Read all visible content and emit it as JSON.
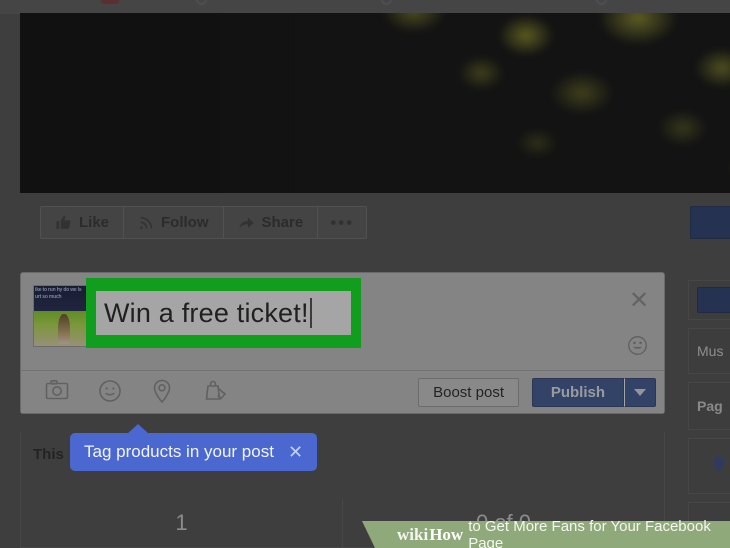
{
  "window": {
    "background_color": "#4f4f4f",
    "dim_overlay": true
  },
  "cover_photo": {
    "alt": "dark-photo-with-yellow-green-foliage"
  },
  "page_actions": {
    "buttons": [
      {
        "label": "Like",
        "icon": "thumbs-up-icon"
      },
      {
        "label": "Follow",
        "icon": "rss-feed-icon"
      },
      {
        "label": "Share",
        "icon": "share-arrow-icon"
      },
      {
        "label": "•••",
        "icon": "more-options-icon"
      }
    ],
    "primary_cta_color": "#25396e"
  },
  "composer": {
    "thumbnail_caption": "ike to run hy do we ls urt so much",
    "post_text": "Win a free ticket!",
    "close_label": "✕",
    "emoji_picker_icon": "smiley-face-icon",
    "highlight_color": "#00f319",
    "toolbar_icons": [
      {
        "name": "camera-icon"
      },
      {
        "name": "feeling-activity-smiley-icon"
      },
      {
        "name": "location-pin-icon"
      },
      {
        "name": "tag-products-bag-icon"
      }
    ],
    "boost_label": "Boost post",
    "publish_label": "Publish",
    "publish_caret_icon": "chevron-down-icon",
    "publish_color": "#3a5795"
  },
  "tooltip": {
    "text": "Tag products in your post",
    "close": "✕",
    "color": "#4a68cf"
  },
  "stats": {
    "section_label": "This",
    "cells": [
      "1",
      "0 of 0"
    ]
  },
  "sidebar": {
    "cta_color": "#25396e",
    "items": [
      {
        "label": "",
        "type": "button"
      },
      {
        "label": "Mus",
        "type": "text"
      },
      {
        "label": "Pag",
        "type": "heading"
      },
      {
        "label": "",
        "type": "bulb-icon"
      },
      {
        "label": "",
        "type": "bulb-icon"
      }
    ]
  },
  "watermark": {
    "wiki": "wiki",
    "how": "How",
    "rest": "to Get More Fans for Your Facebook Page",
    "background": "#8fa97a"
  }
}
